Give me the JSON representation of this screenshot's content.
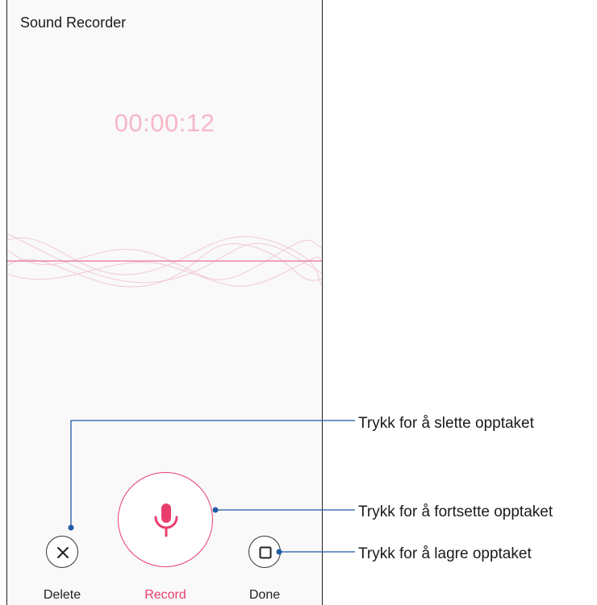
{
  "app": {
    "title": "Sound Recorder"
  },
  "recorder": {
    "elapsed": "00:00:12"
  },
  "controls": {
    "delete_label": "Delete",
    "record_label": "Record",
    "done_label": "Done"
  },
  "icons": {
    "delete": "close-icon",
    "record": "microphone-icon",
    "done": "stop-icon"
  },
  "callouts": {
    "delete": "Trykk for å slette opptaket",
    "record": "Trykk for å fortsette opptaket",
    "done": "Trykk for å lagre opptaket"
  },
  "colors": {
    "accent": "#e83e6e",
    "timer": "#f7b6c6",
    "callout_line": "#1f5aa6"
  }
}
